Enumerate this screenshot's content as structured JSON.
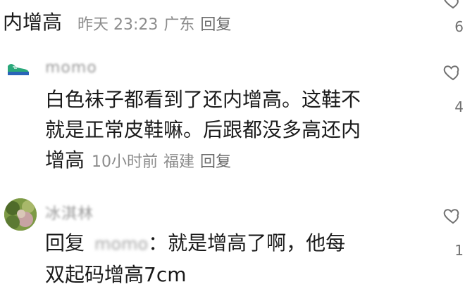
{
  "comment1": {
    "text_tail": "内增高",
    "time": "昨天 23:23",
    "location": "广东",
    "reply_label": "回复",
    "like_count": "6"
  },
  "comment2": {
    "username": "momo",
    "text": "白色袜子都看到了还内增高。这鞋不就是正常皮鞋嘛。后跟都没多高还内增高",
    "line1": "白色袜子都看到了还内增高。这鞋不",
    "line2": "就是正常皮鞋嘛。后跟都没多高还内",
    "line3": "增高",
    "time": "10小时前",
    "location": "福建",
    "reply_label": "回复",
    "like_count": "4",
    "avatar_icon": "sneaker-icon"
  },
  "comment3": {
    "username": "冰淇林",
    "reply_prefix": "回复",
    "reply_to": "momo",
    "text_after_mention": "：就是增高了啊，他每",
    "line2": "双起码增高7cm",
    "like_count": "1",
    "avatar_icon": "avatar-photo"
  },
  "icons": {
    "like": "heart-outline-icon"
  },
  "colors": {
    "text": "#1a1a1a",
    "meta": "#8c8c8c",
    "count": "#707070",
    "sneaker_green": "#2aa87a",
    "sneaker_blue": "#2a64b8"
  }
}
